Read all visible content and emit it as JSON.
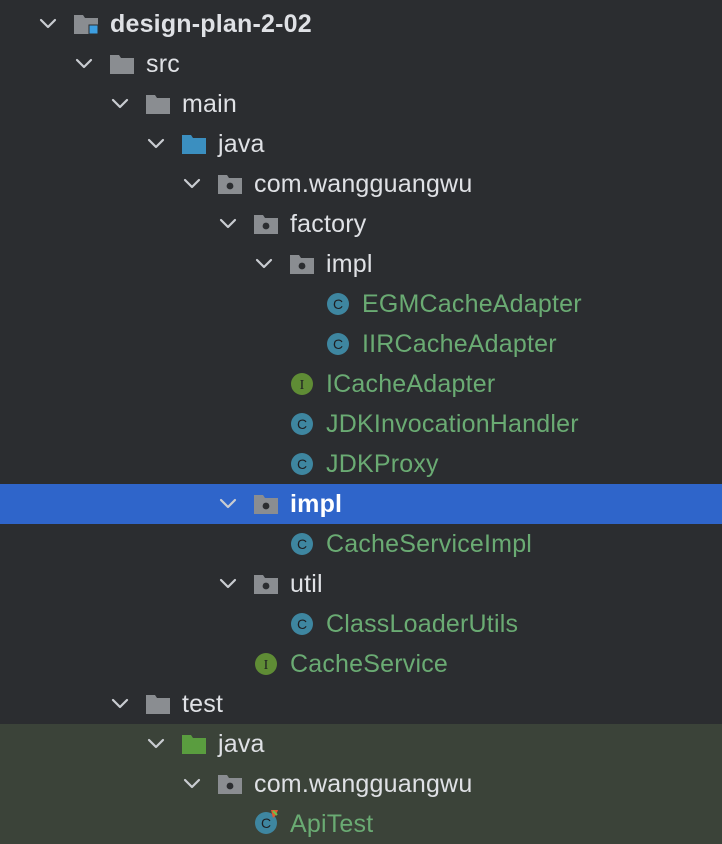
{
  "colors": {
    "background": "#2b2d30",
    "selection": "#2f65ca",
    "test_area": "#3b4339",
    "folder": "#8a8d91",
    "source_root": "#3b8fc0",
    "test_root": "#5a9d3f",
    "class_badge": "#3e86a0",
    "interface_badge": "#5f8c35",
    "class_text": "#6aab73",
    "default_text": "#dfe1e5"
  },
  "tree": [
    {
      "label": "design-plan-2-02",
      "depth": 0,
      "expanded": true,
      "icon": "module-folder-icon",
      "bold": true
    },
    {
      "label": "src",
      "depth": 1,
      "expanded": true,
      "icon": "folder-icon"
    },
    {
      "label": "main",
      "depth": 2,
      "expanded": true,
      "icon": "folder-icon"
    },
    {
      "label": "java",
      "depth": 3,
      "expanded": true,
      "icon": "source-root-folder-icon"
    },
    {
      "label": "com.wangguangwu",
      "depth": 4,
      "expanded": true,
      "icon": "package-icon"
    },
    {
      "label": "factory",
      "depth": 5,
      "expanded": true,
      "icon": "package-icon"
    },
    {
      "label": "impl",
      "depth": 6,
      "expanded": true,
      "icon": "package-icon"
    },
    {
      "label": "EGMCacheAdapter",
      "depth": 7,
      "icon": "class-icon",
      "kind": "class"
    },
    {
      "label": "IIRCacheAdapter",
      "depth": 7,
      "icon": "class-icon",
      "kind": "class"
    },
    {
      "label": "ICacheAdapter",
      "depth": 6,
      "icon": "interface-icon",
      "kind": "class"
    },
    {
      "label": "JDKInvocationHandler",
      "depth": 6,
      "icon": "class-icon",
      "kind": "class"
    },
    {
      "label": "JDKProxy",
      "depth": 6,
      "icon": "class-icon",
      "kind": "class"
    },
    {
      "label": "impl",
      "depth": 5,
      "expanded": true,
      "icon": "package-icon",
      "selected": true,
      "bold": true
    },
    {
      "label": "CacheServiceImpl",
      "depth": 6,
      "icon": "class-icon",
      "kind": "class"
    },
    {
      "label": "util",
      "depth": 5,
      "expanded": true,
      "icon": "package-icon"
    },
    {
      "label": "ClassLoaderUtils",
      "depth": 6,
      "icon": "class-icon",
      "kind": "class"
    },
    {
      "label": "CacheService",
      "depth": 5,
      "icon": "interface-icon",
      "kind": "class"
    },
    {
      "label": "test",
      "depth": 2,
      "expanded": true,
      "icon": "folder-icon"
    },
    {
      "label": "java",
      "depth": 3,
      "expanded": true,
      "icon": "test-root-folder-icon",
      "test_area": true
    },
    {
      "label": "com.wangguangwu",
      "depth": 4,
      "expanded": true,
      "icon": "package-icon",
      "test_area": true
    },
    {
      "label": "ApiTest",
      "depth": 5,
      "icon": "test-class-icon",
      "kind": "class",
      "test_area": true
    }
  ]
}
